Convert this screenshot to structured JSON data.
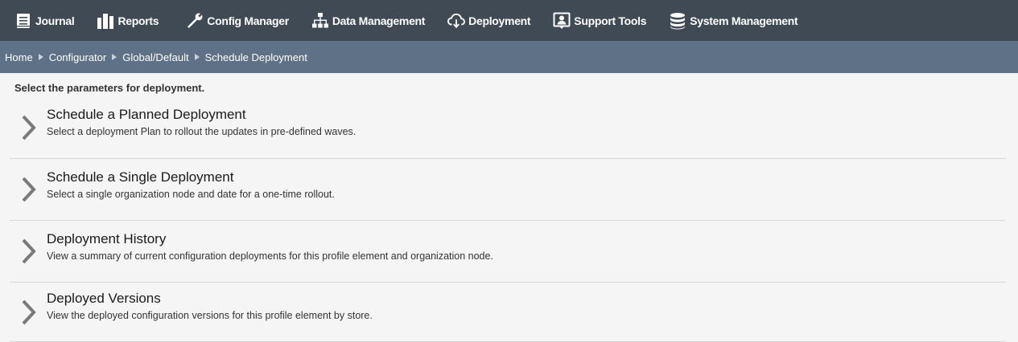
{
  "nav": {
    "items": [
      {
        "label": "Journal",
        "icon": "book-icon"
      },
      {
        "label": "Reports",
        "icon": "bar-chart-icon"
      },
      {
        "label": "Config Manager",
        "icon": "wrench-icon"
      },
      {
        "label": "Data Management",
        "icon": "org-tree-icon"
      },
      {
        "label": "Deployment",
        "icon": "cloud-download-icon"
      },
      {
        "label": "Support Tools",
        "icon": "support-person-icon"
      },
      {
        "label": "System Management",
        "icon": "database-icon"
      }
    ]
  },
  "breadcrumb": {
    "items": [
      "Home",
      "Configurator",
      "Global/Default",
      "Schedule Deployment"
    ]
  },
  "instructions": "Select the parameters for deployment.",
  "options": [
    {
      "title": "Schedule a Planned Deployment",
      "description": "Select a deployment Plan to rollout the updates in pre-defined waves."
    },
    {
      "title": "Schedule a Single Deployment",
      "description": "Select a single organization node and date for a one-time rollout."
    },
    {
      "title": "Deployment History",
      "description": "View a summary of current configuration deployments for this profile element and organization node."
    },
    {
      "title": "Deployed Versions",
      "description": "View the deployed configuration versions for this profile element by store."
    }
  ],
  "colors": {
    "topnav_bg": "#3f4a55",
    "breadcrumb_bg": "#5e7186",
    "content_bg": "#f5f5f5",
    "chevron": "#7a7a7a"
  }
}
